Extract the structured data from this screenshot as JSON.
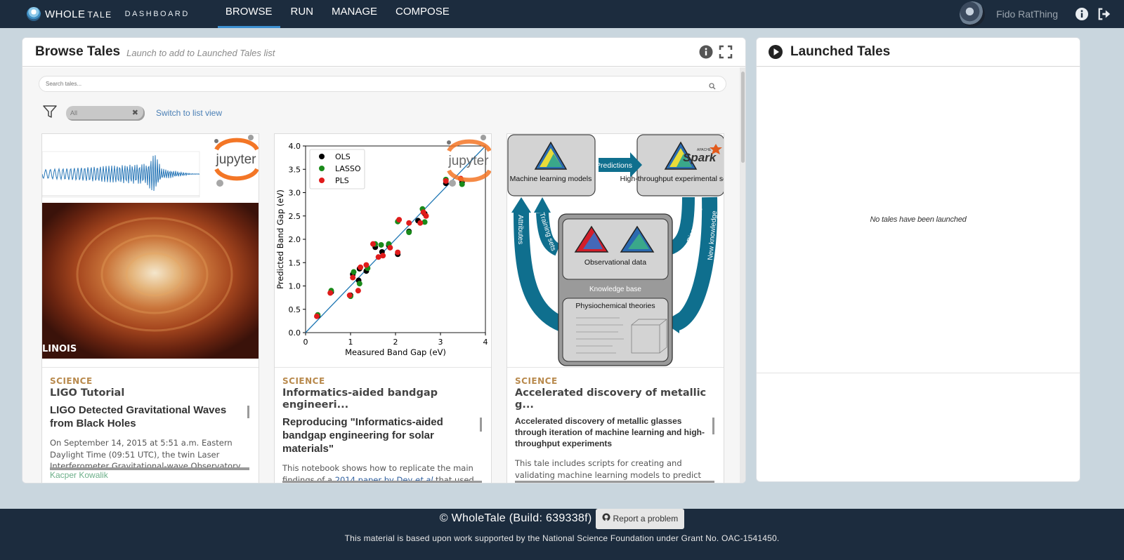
{
  "nav": {
    "logo_whole": "WHOLE",
    "logo_tale": "TALE",
    "dashboard": "DASHBOARD",
    "links": [
      "BROWSE",
      "RUN",
      "MANAGE",
      "COMPOSE"
    ],
    "active": "BROWSE",
    "user_name": "Fido RatThing"
  },
  "browse": {
    "title": "Browse Tales",
    "subtitle": "Launch to add to Launched Tales list",
    "search_placeholder": "Search tales...",
    "filter_chip": "All",
    "switch_view": "Switch to list view"
  },
  "cards": [
    {
      "category": "SCIENCE",
      "title": "LIGO Tutorial",
      "desc_heading": "LIGO Detected Gravitational Waves from Black Holes",
      "desc_text": "On September 14, 2015 at 5:51 a.m. Eastern Daylight Time (09:51 UTC), the twin Laser Interferometer Gravitational-wave Observatory",
      "author": "Kacper Kowalik",
      "image_caption": "LINOIS",
      "badge": "jupyter"
    },
    {
      "category": "SCIENCE",
      "title": "Informatics-aided bandgap engineeri...",
      "desc_heading": "Reproducing \"Informatics-aided bandgap engineering for solar materials\"",
      "desc_text_before": "This notebook shows how to replicate the main findings of a ",
      "desc_link": "2014 paper by Dey",
      "desc_em": "et al",
      "desc_text_after": " that used machine learning to predict the band gap",
      "badge": "jupyter"
    },
    {
      "category": "SCIENCE",
      "title": "Accelerated discovery of metallic g...",
      "desc_heading": "Accelerated discovery of metallic glasses through iteration of machine learning and high-throughput experiments",
      "desc_text": "This tale includes scripts for creating and validating machine learning models to predict"
    }
  ],
  "chart_data": {
    "type": "scatter",
    "xlabel": "Measured Band Gap (eV)",
    "ylabel": "Predicted Band Gap (eV)",
    "xlim": [
      0,
      4
    ],
    "ylim": [
      0,
      4
    ],
    "x_ticks": [
      "0",
      "1",
      "2",
      "3",
      "4"
    ],
    "y_ticks": [
      "0.0",
      "0.5",
      "1.0",
      "1.5",
      "2.0",
      "2.5",
      "3.0",
      "3.5",
      "4.0"
    ],
    "legend_position": "top-left",
    "diagonal": true,
    "series": [
      {
        "name": "OLS",
        "color": "#000000",
        "x": [
          0.27,
          0.57,
          1.0,
          1.05,
          1.18,
          1.2,
          1.35,
          1.55,
          1.7,
          1.85,
          2.05,
          2.3,
          2.5,
          2.65,
          3.12,
          3.48
        ],
        "y": [
          0.36,
          0.87,
          0.8,
          1.25,
          1.12,
          1.37,
          1.32,
          1.83,
          1.73,
          1.87,
          1.68,
          2.17,
          2.4,
          2.55,
          3.2,
          3.22
        ]
      },
      {
        "name": "LASSO",
        "color": "#1a8a1a",
        "x": [
          0.27,
          0.57,
          1.0,
          1.07,
          1.2,
          1.38,
          1.55,
          1.68,
          1.85,
          2.05,
          2.3,
          2.6,
          2.65,
          3.12,
          3.48
        ],
        "y": [
          0.38,
          0.9,
          0.78,
          1.3,
          1.05,
          1.38,
          1.9,
          1.88,
          1.9,
          2.38,
          2.15,
          2.65,
          2.37,
          3.28,
          3.18
        ]
      },
      {
        "name": "PLS",
        "color": "#e01b1b",
        "x": [
          0.25,
          0.55,
          0.98,
          1.05,
          1.17,
          1.22,
          1.35,
          1.5,
          1.62,
          1.72,
          1.88,
          2.05,
          2.08,
          2.3,
          2.55,
          2.62,
          2.68,
          3.12,
          3.45
        ],
        "y": [
          0.35,
          0.85,
          0.8,
          1.18,
          0.9,
          1.4,
          1.45,
          1.9,
          1.62,
          1.65,
          1.82,
          1.72,
          2.42,
          2.35,
          2.35,
          2.58,
          2.5,
          3.25,
          3.3
        ]
      }
    ]
  },
  "diagram": {
    "box_ml": "Machine learning models",
    "box_spark": "High-throughput experimental search",
    "arrow_predictions": "Predictions",
    "label_attributes": "Attributes",
    "label_training": "Training sets",
    "label_discoveries": "Discoveries",
    "label_new_knowledge": "New knowledge",
    "box_observational": "Observational data",
    "knowledge_base": "Knowledge base",
    "box_physio": "Physiochemical theories",
    "spark_apache": "APACHE",
    "spark_name": "Spark"
  },
  "launched": {
    "title": "Launched Tales",
    "empty_message": "No tales have been launched"
  },
  "footer": {
    "copyright": "© WholeTale (Build: 639338f)",
    "report_button": "Report a problem",
    "funding": "This material is based upon work supported by the National Science Foundation under Grant No. OAC-1541450."
  },
  "colors": {
    "nav_bg": "#1c2c3e",
    "accent": "#3c8fd0",
    "category": "#b8894c",
    "diagram_teal": "#0f6f8e"
  }
}
